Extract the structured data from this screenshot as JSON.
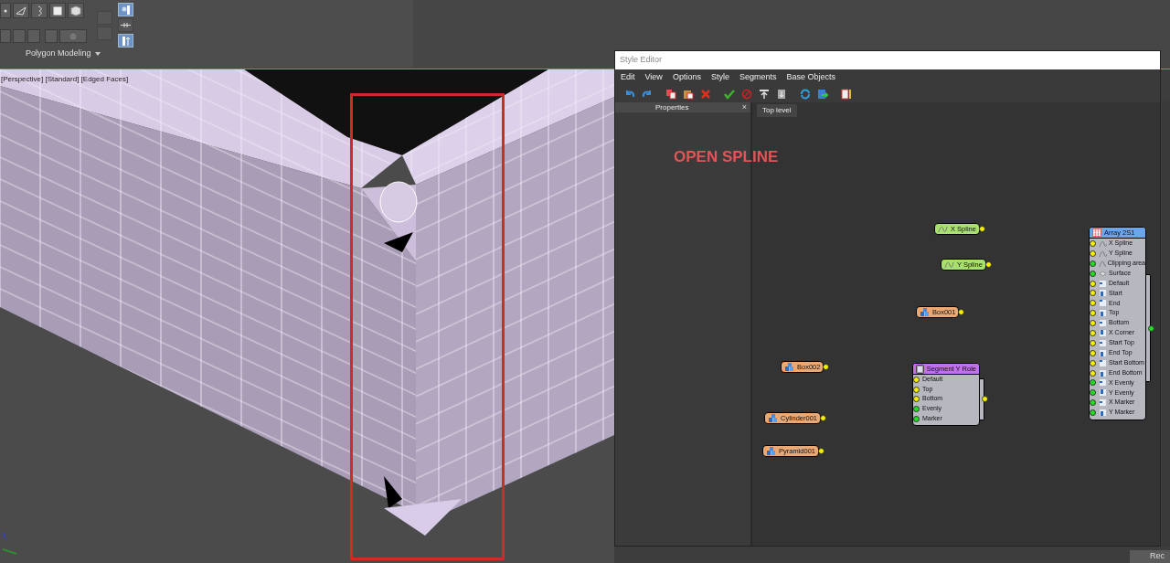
{
  "ribbon": {
    "panel_label": "Polygon Modeling"
  },
  "viewport": {
    "label": "[Perspective] [Standard] [Edged Faces]"
  },
  "annotation": {
    "text": "OPEN SPLINE"
  },
  "style_editor": {
    "title": "Style Editor",
    "menu": [
      "Edit",
      "View",
      "Options",
      "Style",
      "Segments",
      "Base Objects"
    ],
    "properties_panel": {
      "title": "Properties",
      "close_glyph": "×"
    },
    "tabs": [
      {
        "label": "Top level",
        "selected": true
      }
    ],
    "nodes": [
      {
        "kind": "spline",
        "label": "X Spline"
      },
      {
        "kind": "spline",
        "label": "Y Spline"
      },
      {
        "kind": "object",
        "label": "Box001"
      },
      {
        "kind": "object",
        "label": "Box002"
      },
      {
        "kind": "object",
        "label": "Cylinder001"
      },
      {
        "kind": "object",
        "label": "Pyramid001"
      },
      {
        "kind": "segment",
        "label": "Segment Y Role",
        "output_connected": true,
        "ports": [
          {
            "label": "Default",
            "connected": true
          },
          {
            "label": "Top",
            "connected": true
          },
          {
            "label": "Bottom",
            "connected": true
          },
          {
            "label": "Evenly",
            "connected": false
          },
          {
            "label": "Marker",
            "connected": false
          }
        ]
      },
      {
        "kind": "array",
        "label": "Array 2S1",
        "output_connected": false,
        "ports": [
          {
            "label": "X Spline",
            "connected": true
          },
          {
            "label": "Y Spline",
            "connected": true
          },
          {
            "label": "Clipping area",
            "connected": false
          },
          {
            "label": "Surface",
            "connected": false
          },
          {
            "label": "Default",
            "connected": true
          },
          {
            "label": "Start",
            "connected": true
          },
          {
            "label": "End",
            "connected": true
          },
          {
            "label": "Top",
            "connected": true
          },
          {
            "label": "Bottom",
            "connected": true
          },
          {
            "label": "X Corner",
            "connected": true
          },
          {
            "label": "Start Top",
            "connected": true
          },
          {
            "label": "End Top",
            "connected": true
          },
          {
            "label": "Start Bottom",
            "connected": true
          },
          {
            "label": "End Bottom",
            "connected": true
          },
          {
            "label": "X Evenly",
            "connected": false
          },
          {
            "label": "Y Evenly",
            "connected": false
          },
          {
            "label": "X Marker",
            "connected": false
          },
          {
            "label": "Y Marker",
            "connected": false
          }
        ]
      }
    ]
  },
  "side_panel": {
    "button_label": "Rec"
  }
}
